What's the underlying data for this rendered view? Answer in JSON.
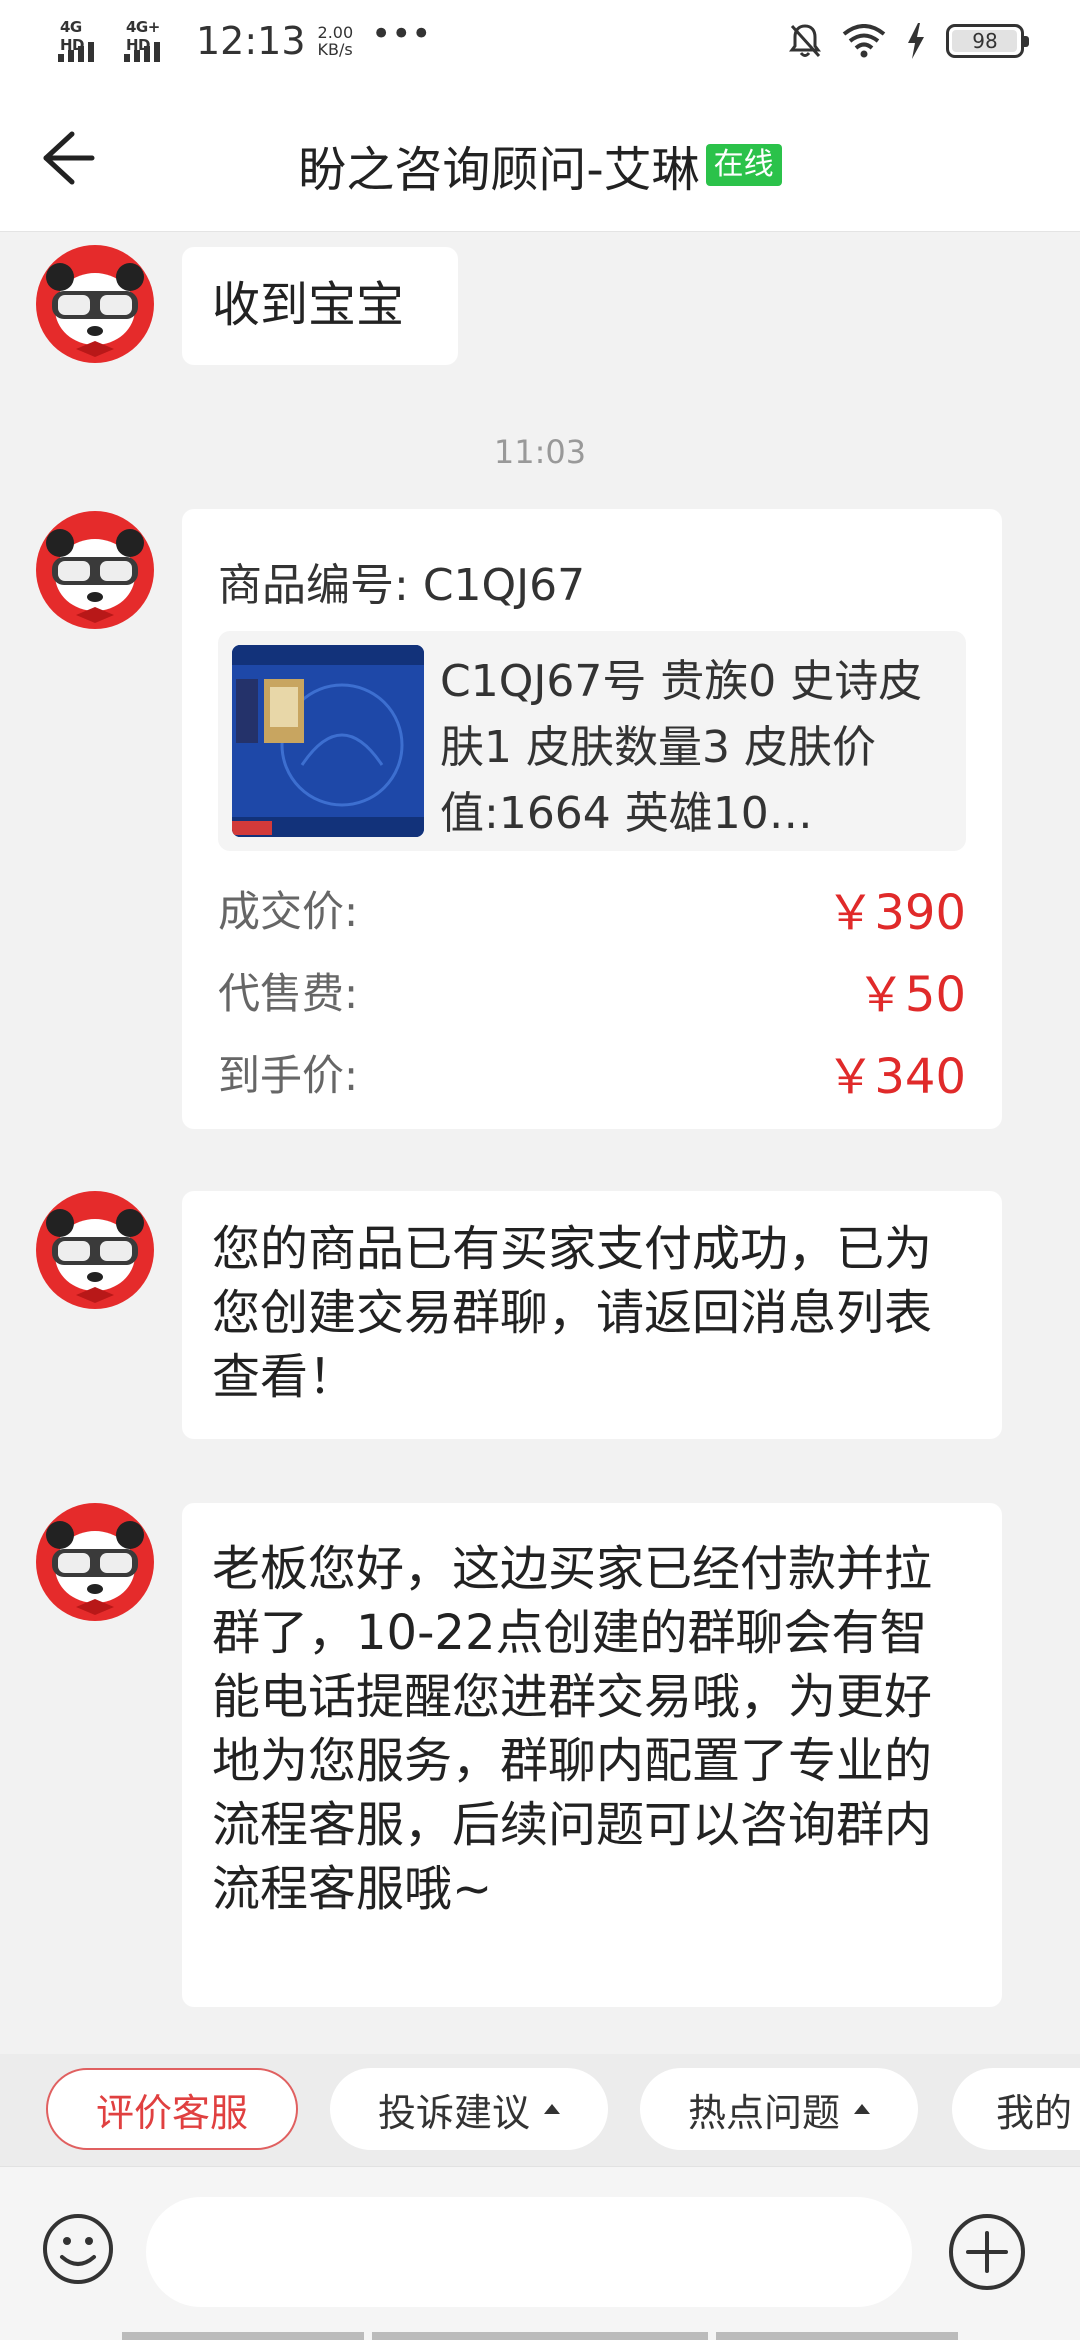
{
  "status_bar": {
    "network1": "4G HD",
    "network2": "4G+ HD",
    "time": "12:13",
    "speed_value": "2.00",
    "speed_unit": "KB/s",
    "more": "•••",
    "battery": "98"
  },
  "header": {
    "title": "盼之咨询顾问-艾琳",
    "status": "在线"
  },
  "chat": {
    "msg1": "收到宝宝",
    "time_label": "11:03",
    "order": {
      "number_label": "商品编号:",
      "number_value": "C1QJ67",
      "description": "C1QJ67号 贵族0 史诗皮肤1 皮肤数量3 皮肤价值:1664 英雄10…",
      "deal_price_label": "成交价:",
      "deal_price_value": "￥390",
      "fee_label": "代售费:",
      "fee_value": "￥50",
      "net_label": "到手价:",
      "net_value": "￥340"
    },
    "msg2": "您的商品已有买家支付成功，已为您创建交易群聊，请返回消息列表查看！",
    "msg3": "老板您好，这边买家已经付款并拉群了，10-22点创建的群聊会有智能电话提醒您进群交易哦，为更好地为您服务，群聊内配置了专业的流程客服，后续问题可以咨询群内流程客服哦~"
  },
  "quick_actions": {
    "rate": "评价客服",
    "complain": "投诉建议",
    "hot": "热点问题",
    "mine": "我的"
  },
  "input": {
    "placeholder": ""
  },
  "colors": {
    "accent_red": "#e02a2a",
    "online_green": "#2bc24a"
  }
}
